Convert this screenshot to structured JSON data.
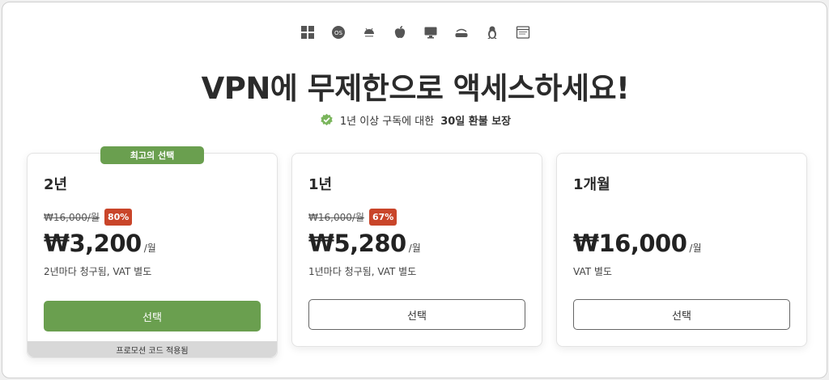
{
  "os_icons": [
    "windows-icon",
    "macos-icon",
    "android-icon",
    "apple-icon",
    "desktop-icon",
    "router-icon",
    "linux-icon",
    "browser-icon"
  ],
  "headline": "VPN에 무제한으로 액세스하세요!",
  "guarantee": {
    "prefix": "1년 이상 구독에 대한",
    "highlight": "30일 환불 보장",
    "icon": "badge-check-icon",
    "icon_color": "#7ab55c"
  },
  "colors": {
    "accent": "#6a9f4f",
    "discount_badge": "#c9452a"
  },
  "plans": [
    {
      "term": "2년",
      "tag": "최고의 선택",
      "old_price": "₩16,000/월",
      "discount": "80%",
      "price": "₩3,200",
      "per": "/월",
      "billing": "2년마다 청구됨, VAT 별도",
      "button": "선택",
      "promo": "프로모션 코드 적용됨"
    },
    {
      "term": "1년",
      "old_price": "₩16,000/월",
      "discount": "67%",
      "price": "₩5,280",
      "per": "/월",
      "billing": "1년마다 청구됨, VAT 별도",
      "button": "선택"
    },
    {
      "term": "1개월",
      "price": "₩16,000",
      "per": "/월",
      "billing": "VAT 별도",
      "button": "선택"
    }
  ]
}
